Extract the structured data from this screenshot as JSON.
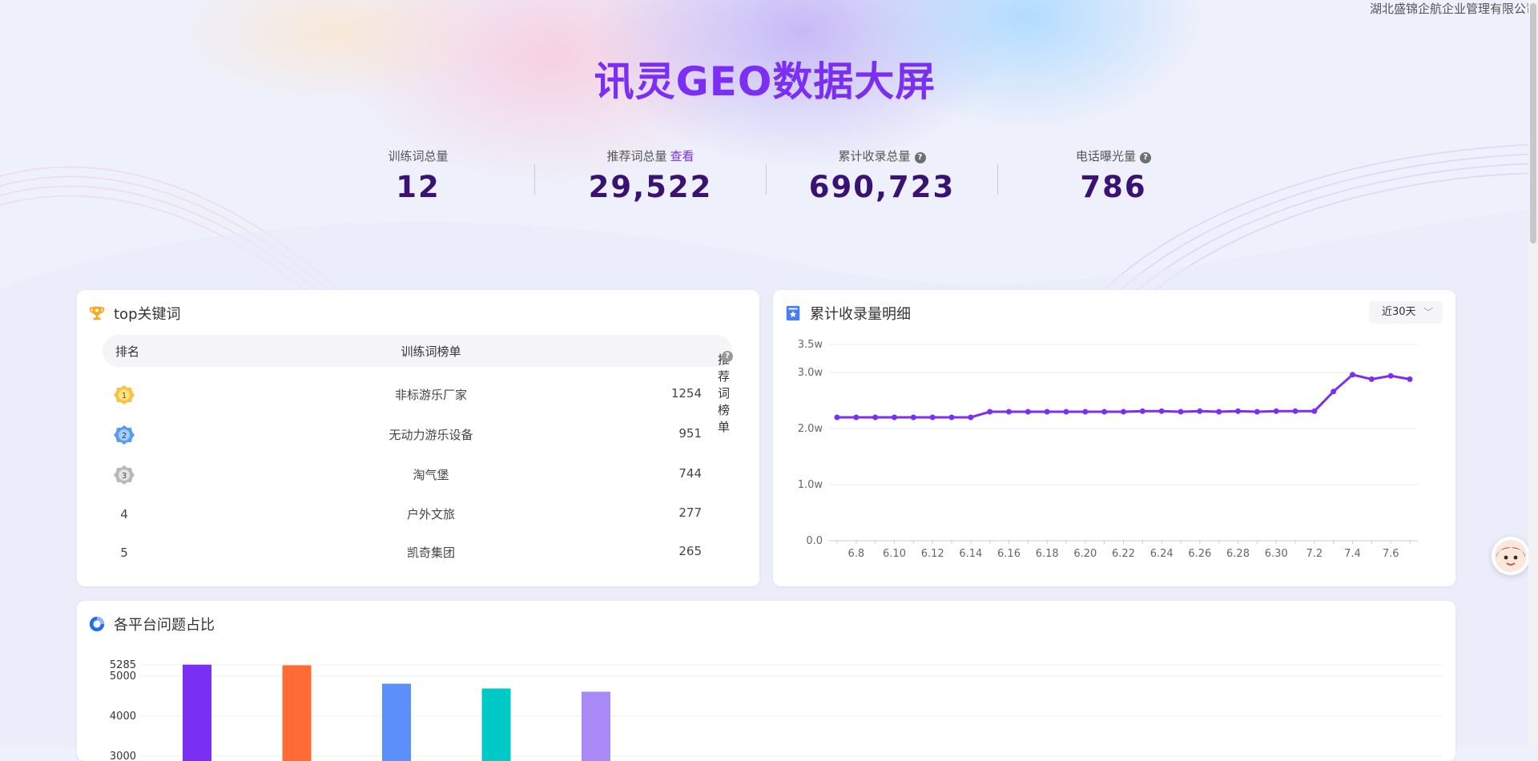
{
  "company": "湖北盛锦企航企业管理有限公司",
  "title": "讯灵GEO数据大屏",
  "stats": [
    {
      "label": "训练词总量",
      "value": "12"
    },
    {
      "label": "推荐词总量",
      "link": "查看",
      "value": "29,522"
    },
    {
      "label": "累计收录总量",
      "value": "690,723",
      "help": "?"
    },
    {
      "label": "电话曝光量",
      "value": "786",
      "help": "?"
    }
  ],
  "top_keywords": {
    "title": "top关键词",
    "headers": {
      "rank": "排名",
      "word": "训练词榜单",
      "count": "推荐词榜单"
    },
    "rows": [
      {
        "rank": "1",
        "word": "非标游乐厂家",
        "count": "1254"
      },
      {
        "rank": "2",
        "word": "无动力游乐设备",
        "count": "951"
      },
      {
        "rank": "3",
        "word": "淘气堡",
        "count": "744"
      },
      {
        "rank": "4",
        "word": "户外文旅",
        "count": "277"
      },
      {
        "rank": "5",
        "word": "凯奇集团",
        "count": "265"
      }
    ]
  },
  "collect_card": {
    "title": "累计收录量明细",
    "range_select": "近30天"
  },
  "platform_card": {
    "title": "各平台问题占比"
  },
  "chart_data": [
    {
      "type": "line",
      "x": [
        "6.7",
        "6.8",
        "6.9",
        "6.10",
        "6.11",
        "6.12",
        "6.13",
        "6.14",
        "6.15",
        "6.16",
        "6.17",
        "6.18",
        "6.19",
        "6.20",
        "6.21",
        "6.22",
        "6.23",
        "6.24",
        "6.25",
        "6.26",
        "6.27",
        "6.28",
        "6.29",
        "6.30",
        "7.1",
        "7.2",
        "7.3",
        "7.4",
        "7.5",
        "7.6"
      ],
      "x_tick_labels": [
        "6.8",
        "6.10",
        "6.12",
        "6.14",
        "6.16",
        "6.18",
        "6.20",
        "6.22",
        "6.24",
        "6.26",
        "6.28",
        "6.30",
        "7.2",
        "7.4",
        "7.6"
      ],
      "y_tick_labels": [
        "0.0",
        "1.0w",
        "2.0w",
        "3.0w",
        "3.5w"
      ],
      "y_ticks": [
        0,
        10000,
        20000,
        30000,
        35000
      ],
      "ylim": [
        0,
        35000
      ],
      "series": [
        {
          "values": [
            22000,
            22000,
            22000,
            22000,
            22000,
            22000,
            22000,
            22000,
            23000,
            23000,
            23000,
            23000,
            23000,
            23000,
            23000,
            23000,
            23100,
            23100,
            23000,
            23100,
            23000,
            23100,
            23000,
            23100,
            23100,
            23100,
            26600,
            29600,
            28800,
            29400,
            28800
          ]
        }
      ],
      "color": "#7b2ff2",
      "grid": true
    },
    {
      "type": "bar",
      "categories": [
        "",
        "",
        "",
        "",
        ""
      ],
      "values": [
        5285,
        5270,
        4810,
        4690,
        4610
      ],
      "colors": [
        "#7b2ff2",
        "#ff6b35",
        "#5b8ff9",
        "#00c9c8",
        "#a989f5"
      ],
      "y_tick_labels": [
        "5285",
        "5000",
        "4000",
        "3000"
      ],
      "y_ticks": [
        5285,
        5000,
        4000,
        3000
      ]
    }
  ]
}
